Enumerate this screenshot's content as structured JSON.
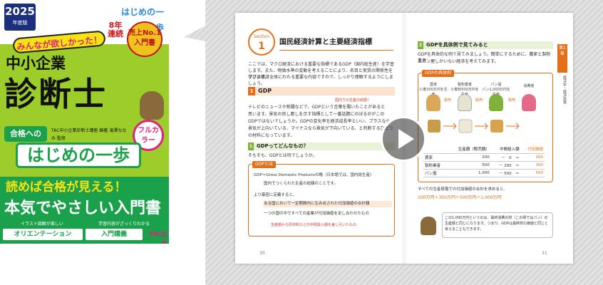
{
  "cover": {
    "year": "2025",
    "year_suffix": "年度版",
    "catch": "みんなが欲しかった！",
    "series_logo": "はじめの一歩",
    "streak": "8年連続",
    "badge": "売上No.1 入門書",
    "title_sub": "中小企業",
    "title_main": "診断士",
    "pass_label": "合格への",
    "authors": "TAC中小企業診断士講座 編著 滝澤ななみ 監修",
    "full_color": "フルカラー",
    "first_step": "はじめの一歩",
    "slogan1": "読めば合格が見える！",
    "slogan2": "本気でやさしい入門書",
    "note_left": "イラスト図解が楽しい",
    "note_right": "学習内容がざっくりわかる",
    "tag_left": "オリエンテーション",
    "tag_right": "入門講義",
    "publisher": "TAC出版"
  },
  "left_page": {
    "section_label": "Section",
    "section_number": "1",
    "section_title": "国民経済計算と主要経済指標",
    "intro": [
      "ここでは、マクロ経済における重要な指標であるGDP（国内総生産）を学習します。また、物価水準の変動を考えることにより、名目と実質の関係性を学びます。",
      "マクロ経済全体にわたる重要な内容ですので、しっかり理解するようにしましょう。"
    ],
    "heading1_number": "1",
    "heading1": "GDP",
    "heading1_note": "国内での生産の総額！",
    "body": [
      "テレビのニュースや新聞などで、GDPという言葉を聞いたことがあると",
      "思います。景気の良し悪しを示す指標として一番話題にのぼるのがこの",
      "GDPではないでしょうか。GDPの変化率を経済成長率といい、プラスなら",
      "景気が上向いている、マイナスなら景気が下向いている、と判断するひとつ",
      "の材料になっています。"
    ],
    "sub_number": "1",
    "sub_heading": "GDPってどんなもの？",
    "sub_body": "そもそも、GDPとは何でしょうか。",
    "box_tag": "GDPとは",
    "box_line1": "GDP＝Gross Domestic Productsの略（日本語では、国内総生産）",
    "box_line2": "国内でつくられた生産の総額のことです。",
    "box_line3": "より厳密に定義すると、",
    "box_line4": "ある国において一定期間内に生み出された付加価値の合計額",
    "box_line5": "一つの国の中ですべての産業が付加価値を足し合わせたもの",
    "box_line6": "生産額から原材料などの中間投入額を差し引いたもの",
    "page_number": "30"
  },
  "right_page": {
    "sub_number": "2",
    "sub_heading": "GDPを具体例で見てみると",
    "intro": [
      "GDPを具体的な例で見てみましょう。簡単にするために、農家と製粉業者",
      "とパン屋しかいない経済を考えてみます。"
    ],
    "fig_tag": "GDPの具体例",
    "actors": [
      {
        "name": "農家",
        "note": "小麦200万円を生産"
      },
      {
        "name": "製粉業者",
        "note": "小麦粉500万円を生産"
      },
      {
        "name": "パン屋",
        "note": "パン1,000万円を生産"
      },
      {
        "name": "消費者",
        "note": ""
      }
    ],
    "arrow_label": "販売",
    "table": {
      "headers": [
        "",
        "生産額（販売額）",
        "中間投入額",
        "付加価値"
      ],
      "rows": [
        [
          "農家",
          "200",
          "－　0　＝",
          "200"
        ],
        [
          "製粉業者",
          "500",
          "－ 200　＝",
          "300"
        ],
        [
          "パン屋",
          "1,000",
          "－ 500　＝",
          "500"
        ]
      ]
    },
    "sum_line1": "すべての生産段階での付加価値の合計を求めると、",
    "sum_line2": "200万円＋300万円＋500万円＝1,000万円",
    "memo": "この1,000万円というのは、最終消費の財（この例ではパン）の生産額と同じになります。つまり、GDPは最終財の価値と同じと考えることもできます。",
    "side_tab": "第1章",
    "side_text": "経済学・経済政策",
    "page_number": "31"
  },
  "player": {
    "action": "play"
  },
  "colors": {
    "cover_green": "#9ccd2a",
    "cover_dark_green": "#1ba14b",
    "accent_orange": "#e2701a",
    "panel_grey": "#e2e2e2"
  }
}
